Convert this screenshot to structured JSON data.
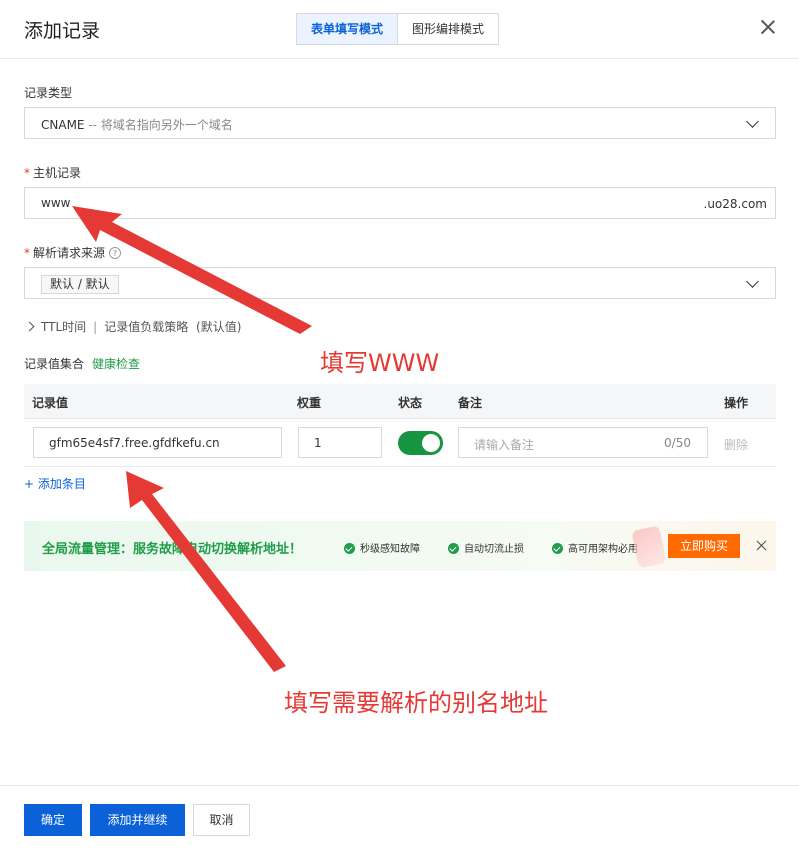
{
  "dialog": {
    "title": "添加记录",
    "modes": [
      "表单填写模式",
      "图形编排模式"
    ]
  },
  "record_type": {
    "label": "记录类型",
    "value": "CNAME",
    "hint": "-- 将域名指向另外一个域名"
  },
  "host_record": {
    "label": "主机记录",
    "value": "www",
    "suffix": ".uo28.com"
  },
  "resolve_source": {
    "label": "解析请求来源",
    "help": "?",
    "value": "默认 / 默认"
  },
  "advanced": {
    "ttl": "TTL时间",
    "divider": "|",
    "strategy": "记录值负载策略",
    "strategy_default": "(默认值)"
  },
  "record_set": {
    "label": "记录值集合",
    "health_check": "健康检查",
    "columns": [
      "记录值",
      "权重",
      "状态",
      "备注",
      "操作"
    ],
    "row": {
      "value": "gfm65e4sf7.free.gfdfkefu.cn",
      "weight": "1",
      "enabled": true,
      "remark_placeholder": "请输入备注",
      "remark_count": "0/50",
      "action": "删除"
    },
    "add_item": "+ 添加条目"
  },
  "banner": {
    "text": "全局流量管理：服务故障自动切换解析地址！",
    "features": [
      "秒级感知故障",
      "自动切流止损",
      "高可用架构必用"
    ],
    "buy_label": "立即购买"
  },
  "footer": {
    "confirm": "确定",
    "add_continue": "添加并继续",
    "cancel": "取消"
  },
  "annotations": {
    "fill_www": "填写WWW",
    "fill_alias": "填写需要解析的别名地址"
  },
  "colors": {
    "primary": "#0b62d8",
    "success": "#16943f",
    "annotation": "#e53935",
    "buy": "#ff6a00"
  }
}
